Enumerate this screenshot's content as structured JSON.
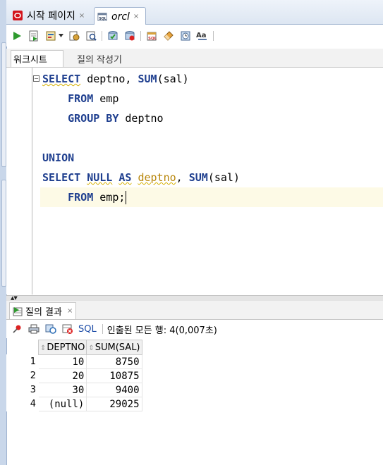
{
  "tabs": [
    {
      "label": "시작 페이지",
      "close": "×"
    },
    {
      "label": "orcl",
      "close": "×"
    }
  ],
  "subtabs": {
    "worksheet": "워크시트",
    "query_builder": "질의 작성기"
  },
  "editor": {
    "lines": [
      [
        {
          "t": "SELECT",
          "c": "kw sq"
        },
        {
          "t": " deptno, "
        },
        {
          "t": "SUM",
          "c": "kw"
        },
        {
          "t": "(sal)"
        }
      ],
      [
        {
          "t": "    "
        },
        {
          "t": "FROM",
          "c": "kw"
        },
        {
          "t": " emp"
        }
      ],
      [
        {
          "t": "    "
        },
        {
          "t": "GROUP BY",
          "c": "kw"
        },
        {
          "t": " deptno"
        }
      ],
      [],
      [
        {
          "t": "UNION",
          "c": "kw"
        }
      ],
      [
        {
          "t": "SELECT",
          "c": "kw"
        },
        {
          "t": " "
        },
        {
          "t": "NULL",
          "c": "kw sq"
        },
        {
          "t": " "
        },
        {
          "t": "AS",
          "c": "kw sq"
        },
        {
          "t": " "
        },
        {
          "t": "deptno",
          "c": "sq olive"
        },
        {
          "t": ", "
        },
        {
          "t": "SUM",
          "c": "kw"
        },
        {
          "t": "(sal)"
        }
      ],
      [
        {
          "t": "    "
        },
        {
          "t": "FROM",
          "c": "kw"
        },
        {
          "t": " emp;"
        }
      ]
    ]
  },
  "results": {
    "tab_label": "질의 결과",
    "tab_close": "×",
    "sql_label": "SQL",
    "status": "인출된 모든 행: 4(0,007초)",
    "columns": [
      "DEPTNO",
      "SUM(SAL)"
    ],
    "rows": [
      {
        "n": "1",
        "cells": [
          "10",
          "8750"
        ]
      },
      {
        "n": "2",
        "cells": [
          "20",
          "10875"
        ]
      },
      {
        "n": "3",
        "cells": [
          "30",
          "9400"
        ]
      },
      {
        "n": "4",
        "cells": [
          "(null)",
          "29025"
        ]
      }
    ]
  },
  "colors": {
    "keyword": "#1f3f8f",
    "link": "#1a4aa6",
    "current_line": "#fdfae6"
  }
}
